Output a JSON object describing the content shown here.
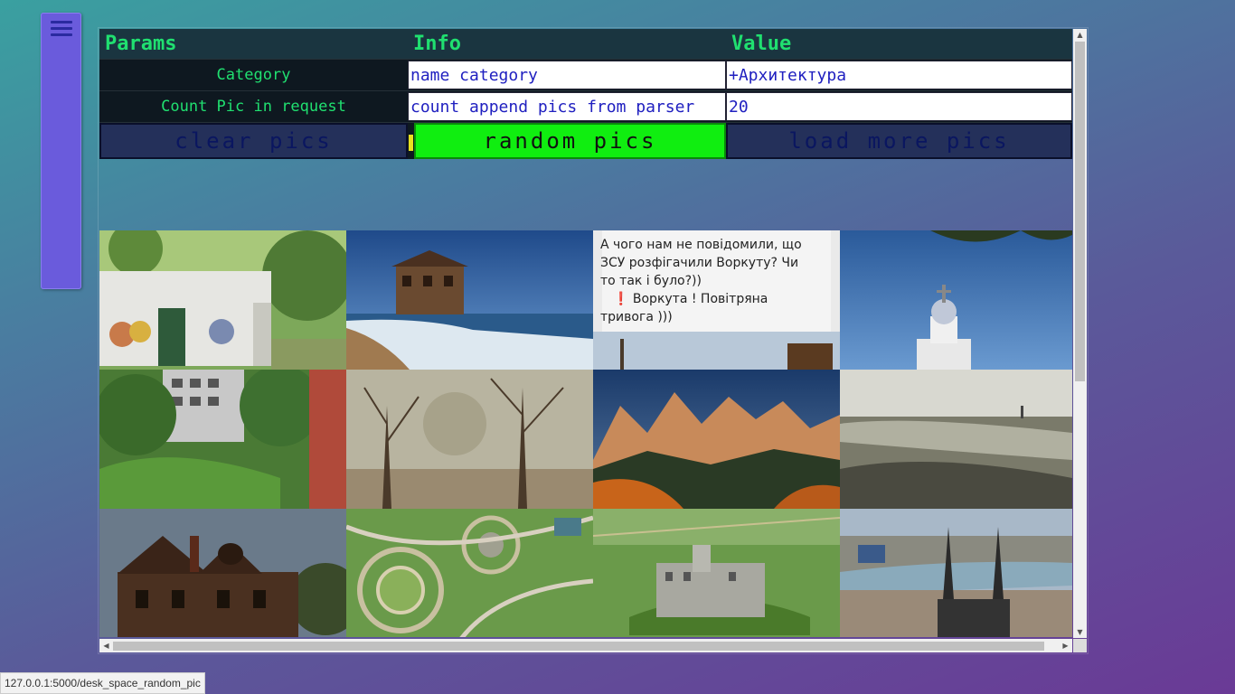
{
  "app": {
    "menu_icon": "hamburger-menu-icon"
  },
  "table": {
    "headers": [
      "Params",
      "Info",
      "Value"
    ],
    "rows": [
      {
        "label": "Category",
        "info_value": "name category",
        "value": "+Архитектура"
      },
      {
        "label": "Count Pic in request",
        "info_value": "count append pics from parser",
        "value": "20"
      }
    ],
    "buttons": {
      "clear": "clear pics",
      "random": "random pics",
      "load": "load more pics"
    }
  },
  "gallery": {
    "post_text_line1": "А чого нам не повідомили, що",
    "post_text_line2": "ЗСУ розфігачили Воркуту? Чи",
    "post_text_line3": "то так і було?))",
    "post_text_line4": "❗ Воркута ! Повітряна",
    "post_text_line5": "тривога )))",
    "images": [
      "painted-utility-building",
      "house-on-beach",
      "text-post-screenshot",
      "church-dome",
      "apartment-yard-fallen-tree",
      "foggy-trees",
      "mountain-peaks",
      "vintage-landscape",
      "old-gothic-mansion",
      "park-aerial-view",
      "castle-ruins-aerial",
      "cathedral-city-river"
    ]
  },
  "status": {
    "url": "127.0.0.1:5000/desk_space_random_pic"
  },
  "colors": {
    "header_text": "#20e070",
    "random_button": "#10ee10",
    "input_text": "#2020c0"
  }
}
